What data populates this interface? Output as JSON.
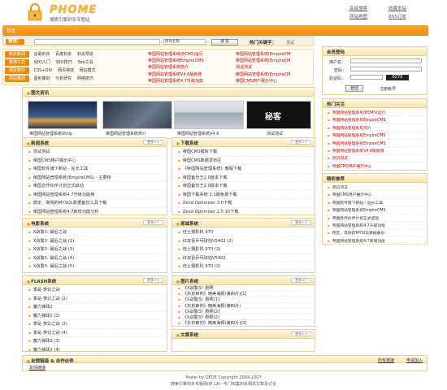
{
  "header": {
    "brand": "PHOME",
    "slogan": "搜索引擎封杀专题站",
    "links_row1": [
      "高级搜索",
      "收藏本站"
    ],
    "links_row2": [
      "网站地图",
      "RSS订阅"
    ]
  },
  "nav": {
    "home": "首页"
  },
  "search": {
    "label": "搜索：",
    "select_value": "所有栏目",
    "button": "搜 索",
    "hot_label": "热门关键字：",
    "hot_keyword": "测试"
  },
  "categories": [
    {
      "tag": "封杀新闻",
      "links": [
        "谷歌封杀",
        "百度封杀",
        "封杀预说"
      ]
    },
    {
      "tag": "常用工具",
      "links": [
        "SEO入门",
        "SEO技巧",
        "Seo工具"
      ]
    },
    {
      "tag": "网页制作",
      "links": [
        "CSS+DIV",
        "网页特效",
        "网站模式"
      ]
    },
    {
      "tag": "网站策划",
      "links": [
        "盈利策划",
        "分析研究",
        "网络技巧"
      ]
    }
  ],
  "top_news_left": [
    "帝国网站管理系统(ECMS)运行",
    "帝国网站管理系统EmpireCMS",
    "帝国网站管理系统简介",
    "帝国网站管理系统V4.6版新增",
    "帝国网站管理系统4.7升级功能"
  ],
  "top_news_right": [
    "帝国网站管理系统(EmpireCM",
    "帝国网站管理系统(EmpireCM",
    "测试测试",
    "帝国网站管理系统(EmpireCM",
    "帝国CMS用户展示中心"
  ],
  "picnews": {
    "title": "图文资讯",
    "captions": [
      "帝国网站管理系统(Emp",
      "帝国网站管理系统简介",
      "帝国网站管理系统V4.6",
      "测试测试"
    ]
  },
  "boxes": {
    "news": {
      "title": "新闻系统",
      "items": [
        "测试测试",
        "帝国CMS用户展示中心",
        "帝国软件旗下新站 - 站长工具",
        "帝国网站管理系统(EmpireCMS) - 主要特",
        "帝国合作伙伴计划正式启动",
        "帝国网站管理系统4.7升级功能用",
        "稳定、高效的MYSQL数据备份工具下载",
        "帝国网站管理系统4.7新增功能分析"
      ]
    },
    "download": {
      "title": "下载系统",
      "items": [
        "帝国CMS模板下载",
        "帝国CMS数据发布区",
        "《帝国网站管理系统》教程下载",
        "帝国备份王2.0版本下载",
        "帝国备份王2.0版本下载",
        "帝国下载系统 2.1版免费下载",
        "Zend Optimizer 3.0下载",
        "Zend Optimizer 2.5.10下载"
      ]
    },
    "movie": {
      "title": "电影系统",
      "items": [
        "X战警3: 最后之战",
        "X战警3: 最后之战 (2)",
        "X战警3: 最后之战 (3)",
        "X战警3: 最后之战 (4)",
        "X战警3: 最后之战 (5)"
      ]
    },
    "shop": {
      "title": "商城系统",
      "items": [
        "佳士摄影机 970",
        "红双喜乒乓球拍V5402 (2)",
        "佳士摄影机 970 (2)",
        "红双喜乒乓球拍V5402",
        "佳士摄影机 970 (3)"
      ]
    },
    "flash": {
      "title": "FLASH系统",
      "items": [
        "季是-梦幻之战",
        "季是-梦幻之战 (2)",
        "魔力弹球2",
        "魔力弹球2 (2)",
        "季是-梦幻之战 (3)",
        "季是-梦幻之战 (4)",
        "魔力弹球2 (3)",
        "魔力弹球2 (4)"
      ]
    },
    "pics": {
      "title": "图片系统",
      "items": [
        "《X战警3》剧照",
        "《东京审判》精美海报(第四片)[1]",
        "《X战警3》剧照[1]",
        "《东京审判》精美海报(第四片)",
        "《X战警3》剧照[2]",
        "《X战警3》剧照(2)",
        "《东京审判》精美海报(第四片)[2]"
      ]
    },
    "article": {
      "title": "文章系统"
    }
  },
  "more_label": "更多>>",
  "sidebar": {
    "login": {
      "title": "会员登陆",
      "user_label": "用户名：",
      "pass_label": "密码：",
      "code_label": "验证码：",
      "code_value": "6279",
      "login_btn": "登陆",
      "register": "注册帐号"
    },
    "hot": {
      "title": "热门关注",
      "items": [
        "帝国网站管理系统(ECMS)运行",
        "帝国网站管理系统EmpireCMS",
        "帝国网站管理系统简介",
        "帝国网站管理系统EmpireCMS",
        "帝国网站管理系统EmpireCMS",
        "帝国网站管理系统V4.6版新增",
        "测试测试",
        "帝国CMS用户展示中心"
      ]
    },
    "recommend": {
      "title": "精彩推荐",
      "items": [
        "测试测试",
        "帝国CMS用户展示中心",
        "帝国软件旗下新站 - 站长工具",
        "帝国网站管理系统EmpireCMS",
        "帝国合作伙伴计划正式启动",
        "帝国网站管理系统4.7升级功能",
        "稳定、高效的MYSQL数据备份",
        "帝国网站管理系统4.7新增功能"
      ]
    }
  },
  "friends": {
    "title": "友情链接 & 合作伙伴",
    "more": "所有链接",
    "apply": "申请加入",
    "link": "友情链接"
  },
  "footer": {
    "line1": "Power by DEDE Copyright 2004-2007",
    "line2": "搜索引擎封杀专题网(IE.LA)--专门收集封杀相关文章及讨论"
  },
  "colors": {
    "accent": "#f08a06",
    "border": "#e5d39c",
    "head_bg": "#f7e6b2"
  }
}
